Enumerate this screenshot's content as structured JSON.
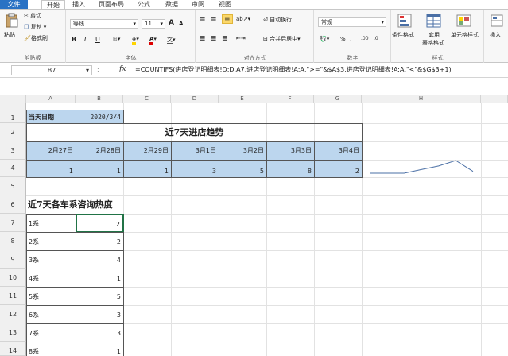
{
  "tabs": [
    "文件",
    "开始",
    "插入",
    "页面布局",
    "公式",
    "数据",
    "审阅",
    "视图"
  ],
  "ribbon": {
    "clipboard": {
      "paste": "粘贴",
      "cut": "剪切",
      "copy": "复制",
      "format_painter": "格式刷",
      "label": "剪贴板"
    },
    "font": {
      "name": "等线",
      "size": "11",
      "label": "字体",
      "grow": "A",
      "shrink": "A",
      "bold": "B",
      "italic": "I",
      "underline": "U",
      "wen": "文"
    },
    "alignment": {
      "wrap": "自动换行",
      "merge": "合并后居中",
      "label": "对齐方式"
    },
    "number": {
      "format": "常规",
      "label": "数字",
      "percent": "%",
      "comma": ","
    },
    "styles": {
      "conditional": "条件格式",
      "table": "套用",
      "table2": "表格格式",
      "cell_styles": "单元格样式",
      "label": "样式"
    },
    "cells": {
      "insert": "插入"
    }
  },
  "formula_bar": {
    "name_box": "B7",
    "fx": "fx",
    "formula": "=COUNTIFS(进店登记明细表!D:D,A7,进店登记明细表!A:A,\">=\"&$A$3,进店登记明细表!A:A,\"<\"&$G$3+1)"
  },
  "columns": [
    "A",
    "B",
    "C",
    "D",
    "E",
    "F",
    "G",
    "H",
    "I"
  ],
  "rows": [
    "1",
    "2",
    "3",
    "4",
    "5",
    "6",
    "7",
    "8",
    "9",
    "10",
    "11",
    "12",
    "13",
    "14"
  ],
  "sheet": {
    "a1": "当天日期",
    "b1": "2020/3/4",
    "title2": "近7天进店趋势",
    "dates": [
      "2月27日",
      "2月28日",
      "2月29日",
      "3月1日",
      "3月2日",
      "3月3日",
      "3月4日"
    ],
    "counts": [
      "1",
      "1",
      "1",
      "3",
      "5",
      "8",
      "2"
    ],
    "title6": "近7天各车系咨询热度",
    "series": [
      {
        "name": "1系",
        "value": "2"
      },
      {
        "name": "2系",
        "value": "2"
      },
      {
        "name": "3系",
        "value": "4"
      },
      {
        "name": "4系",
        "value": "1"
      },
      {
        "name": "5系",
        "value": "5"
      },
      {
        "name": "6系",
        "value": "3"
      },
      {
        "name": "7系",
        "value": "3"
      },
      {
        "name": "8系",
        "value": "1"
      }
    ]
  },
  "sparkline": {
    "values": [
      1,
      1,
      1,
      3,
      5,
      8,
      2
    ],
    "color": "#4a6fa5"
  }
}
